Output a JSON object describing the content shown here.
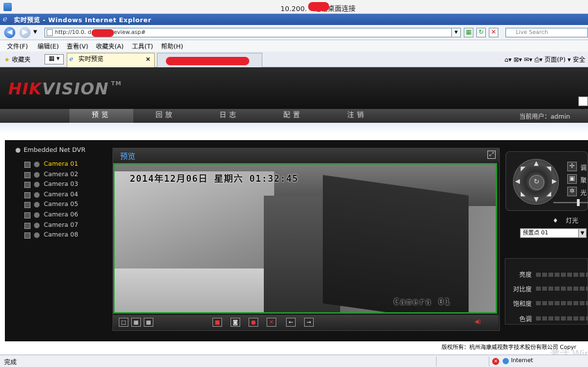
{
  "rdp": {
    "title": "10.200.      - 远程桌面连接"
  },
  "ie": {
    "window_title": "实时预览 - Windows Internet Explorer",
    "address": "http://10.0.         doc/cn/preview.asp#",
    "search_placeholder": "Live Search",
    "menu": [
      "文件(F)",
      "编辑(E)",
      "查看(V)",
      "收藏夹(A)",
      "工具(T)",
      "帮助(H)"
    ],
    "favorites_label": "收藏夹",
    "active_tab": "实时预览",
    "tab_close": "×",
    "right_tools": "页面(P) ▾  安全",
    "status_done": "完成",
    "zone": "Internet"
  },
  "hik": {
    "logo_red": "HIK",
    "logo_gray": "VISION",
    "logo_tm": "TM",
    "nav": [
      "预览",
      "回放",
      "日志",
      "配置",
      "注销"
    ],
    "current_user": "当前用户：admin",
    "device_root": "Embedded Net DVR",
    "cameras": [
      "Camera 01",
      "Camera 02",
      "Camera 03",
      "Camera 04",
      "Camera 05",
      "Camera 06",
      "Camera 07",
      "Camera 08"
    ],
    "selected_camera": "Camera 01",
    "preview_title": "预览",
    "osd_datetime": "2014年12月06日 星期六 01:32:45",
    "osd_camera": "Camera 01",
    "ptz_labels": [
      "调",
      "聚",
      "光"
    ],
    "light_label": "灯光",
    "preset_value": "预置点 01",
    "image_params": [
      "亮度",
      "对比度",
      "饱和度",
      "色调"
    ],
    "copyright": "版权所有：杭州海康威视数字技术股份有限公司 Copyr"
  },
  "colors": {
    "brand_red": "#d0131a",
    "active_green": "#1f9a2a",
    "tab_selected_yellow": "#ffd400"
  },
  "watermark": "激活 Win"
}
